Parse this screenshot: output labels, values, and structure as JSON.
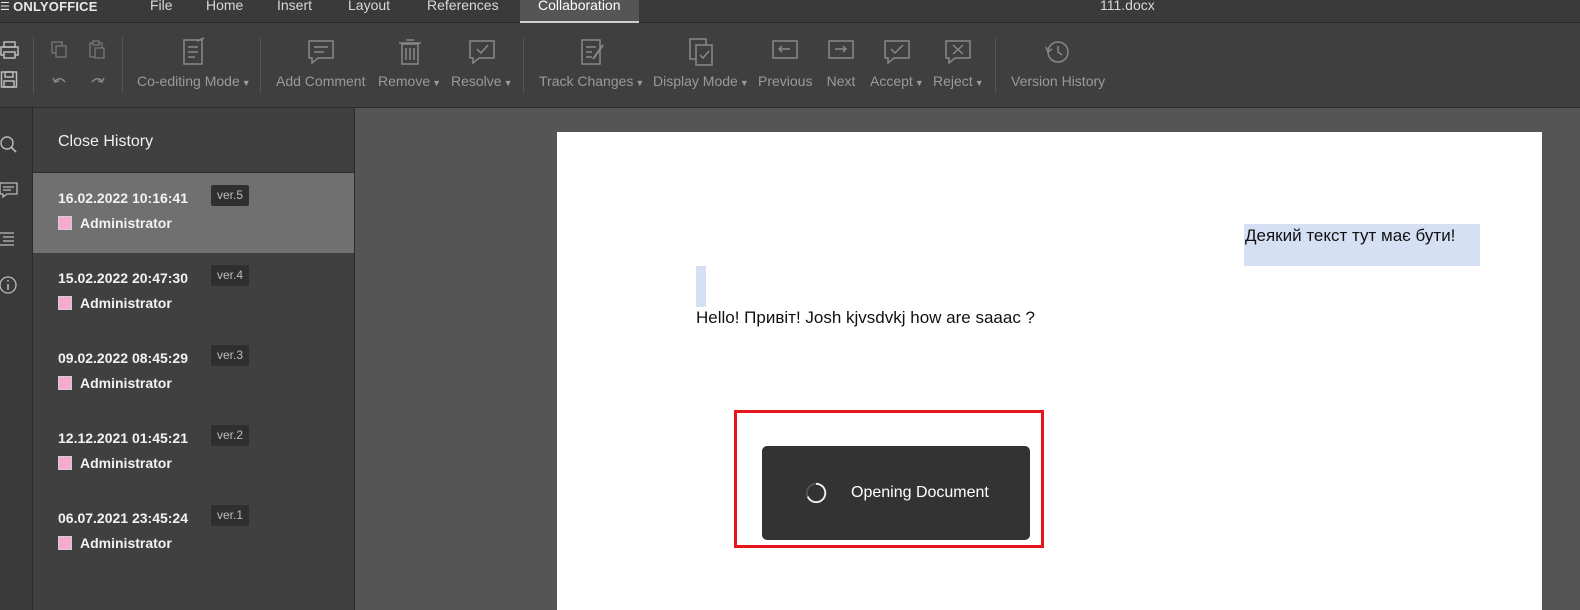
{
  "app": {
    "logo_text": "ONLYOFFICE",
    "document_title": "111.docx"
  },
  "menu": {
    "tabs": [
      "File",
      "Home",
      "Insert",
      "Layout",
      "References",
      "Collaboration"
    ],
    "active_tab": "Collaboration"
  },
  "toolbar": {
    "co_editing": "Co-editing Mode",
    "add_comment": "Add Comment",
    "remove": "Remove",
    "resolve": "Resolve",
    "track_changes": "Track Changes",
    "display_mode": "Display Mode",
    "previous": "Previous",
    "next": "Next",
    "accept": "Accept",
    "reject": "Reject",
    "version_history": "Version History"
  },
  "history": {
    "close_label": "Close History",
    "versions": [
      {
        "date": "16.02.2022 10:16:41",
        "version": "ver.5",
        "user": "Administrator",
        "selected": true
      },
      {
        "date": "15.02.2022 20:47:30",
        "version": "ver.4",
        "user": "Administrator",
        "selected": false
      },
      {
        "date": "09.02.2022 08:45:29",
        "version": "ver.3",
        "user": "Administrator",
        "selected": false
      },
      {
        "date": "12.12.2021 01:45:21",
        "version": "ver.2",
        "user": "Administrator",
        "selected": false
      },
      {
        "date": "06.07.2021 23:45:24",
        "version": "ver.1",
        "user": "Administrator",
        "selected": false
      }
    ],
    "user_color": "#f7a9cf"
  },
  "document": {
    "line1": "Деякий текст тут має бути!",
    "line2": "Hello! Привіт! Josh kjvsdvkj how are saaac ?"
  },
  "overlay": {
    "status_text": "Opening Document"
  },
  "colors": {
    "highlight": "#d6e0f4",
    "annotation_frame": "#e8141c"
  },
  "icons": {
    "toolbar": [
      "print-icon",
      "save-icon",
      "copy-icon",
      "paste-icon",
      "undo-icon",
      "redo-icon",
      "co-editing-icon",
      "comment-icon",
      "trash-icon",
      "resolve-icon",
      "track-changes-icon",
      "display-mode-icon",
      "previous-icon",
      "next-icon",
      "accept-icon",
      "reject-icon",
      "history-icon"
    ],
    "rail": [
      "search-icon",
      "comments-icon",
      "navigation-icon",
      "about-icon"
    ]
  }
}
